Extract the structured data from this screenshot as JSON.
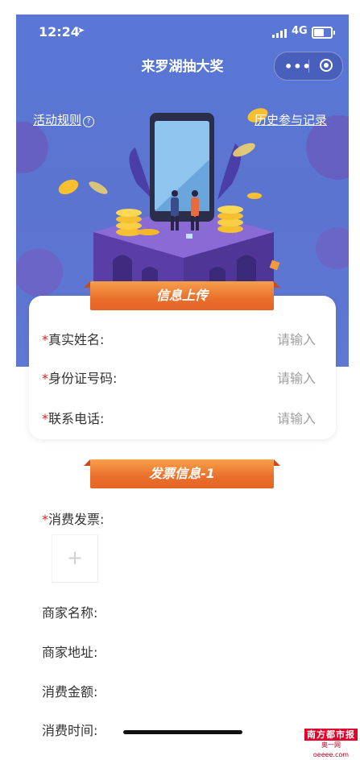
{
  "status_bar": {
    "time": "12:24",
    "network": "4G"
  },
  "nav": {
    "title": "来罗湖抽大奖",
    "capsule_more": "•••"
  },
  "links": {
    "rules": "活动规则",
    "history": "历史参与记录"
  },
  "section1": {
    "title": "信息上传",
    "fields": [
      {
        "required": "*",
        "label": "真实姓名:",
        "placeholder": "请输入"
      },
      {
        "required": "*",
        "label": "身份证号码:",
        "placeholder": "请输入"
      },
      {
        "required": "*",
        "label": "联系电话:",
        "placeholder": "请输入"
      }
    ]
  },
  "section2": {
    "title": "发票信息-1",
    "invoice": {
      "required": "*",
      "label": "消费发票:",
      "upload_symbol": "+"
    },
    "merchant_name": "商家名称:",
    "merchant_address": "商家地址:",
    "amount": "消费金额:",
    "time": "消费时间:"
  },
  "watermark": {
    "top": "南方都市报",
    "bottom": "奥一网 oeeee.com"
  },
  "colors": {
    "hero_bg": "#5b76d2",
    "ribbon": "#ea6f2c",
    "required": "#e02020",
    "placeholder": "#a0a0a0"
  },
  "icons": {
    "help": "question-circle-icon",
    "capsule_close": "target-circle-icon",
    "signal": "signal-bars-icon",
    "battery": "battery-icon",
    "location": "location-arrow-icon"
  }
}
